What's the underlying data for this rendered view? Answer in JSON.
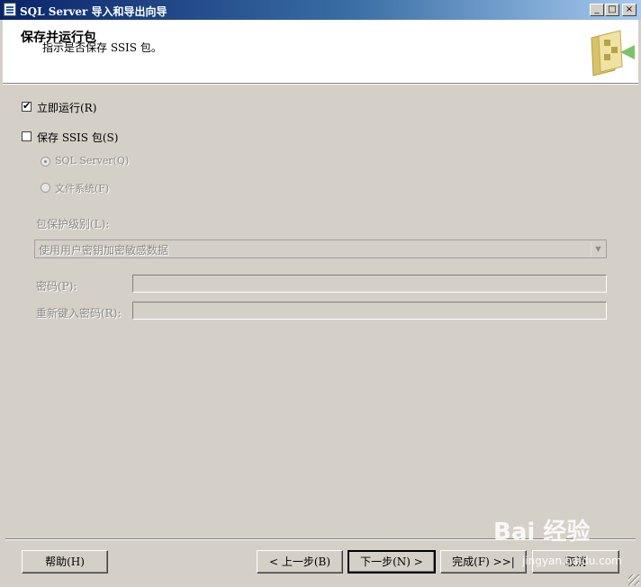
{
  "window": {
    "title": "SQL Server 导入和导出向导"
  },
  "caption_buttons": {
    "minimize": "_",
    "maximize": "□",
    "close": "×"
  },
  "header": {
    "title": "保存并运行包",
    "subtitle": "指示是否保存 SSIS 包。"
  },
  "options": {
    "run_now": {
      "label": "立即运行(R)",
      "checked": true
    },
    "save_ssis": {
      "label": "保存 SSIS 包(S)",
      "checked": false
    },
    "sql_server": {
      "label": "SQL Server(Q)",
      "selected": true,
      "enabled": false
    },
    "file_system": {
      "label": "文件系统(F)",
      "selected": false,
      "enabled": false
    }
  },
  "protection": {
    "label": "包保护级别(L):",
    "value": "使用用户密钥加密敏感数据"
  },
  "password": {
    "label": "密码(P):",
    "value": ""
  },
  "retype_password": {
    "label": "重新键入密码(R):",
    "value": ""
  },
  "buttons": {
    "help": "帮助(H)",
    "back": "< 上一步(B)",
    "next": "下一步(N) >",
    "finish": "完成(F) >>|",
    "cancel": "取消"
  },
  "watermark": {
    "brand": "Bai 经验",
    "url": "jingyan.baidu.com"
  }
}
